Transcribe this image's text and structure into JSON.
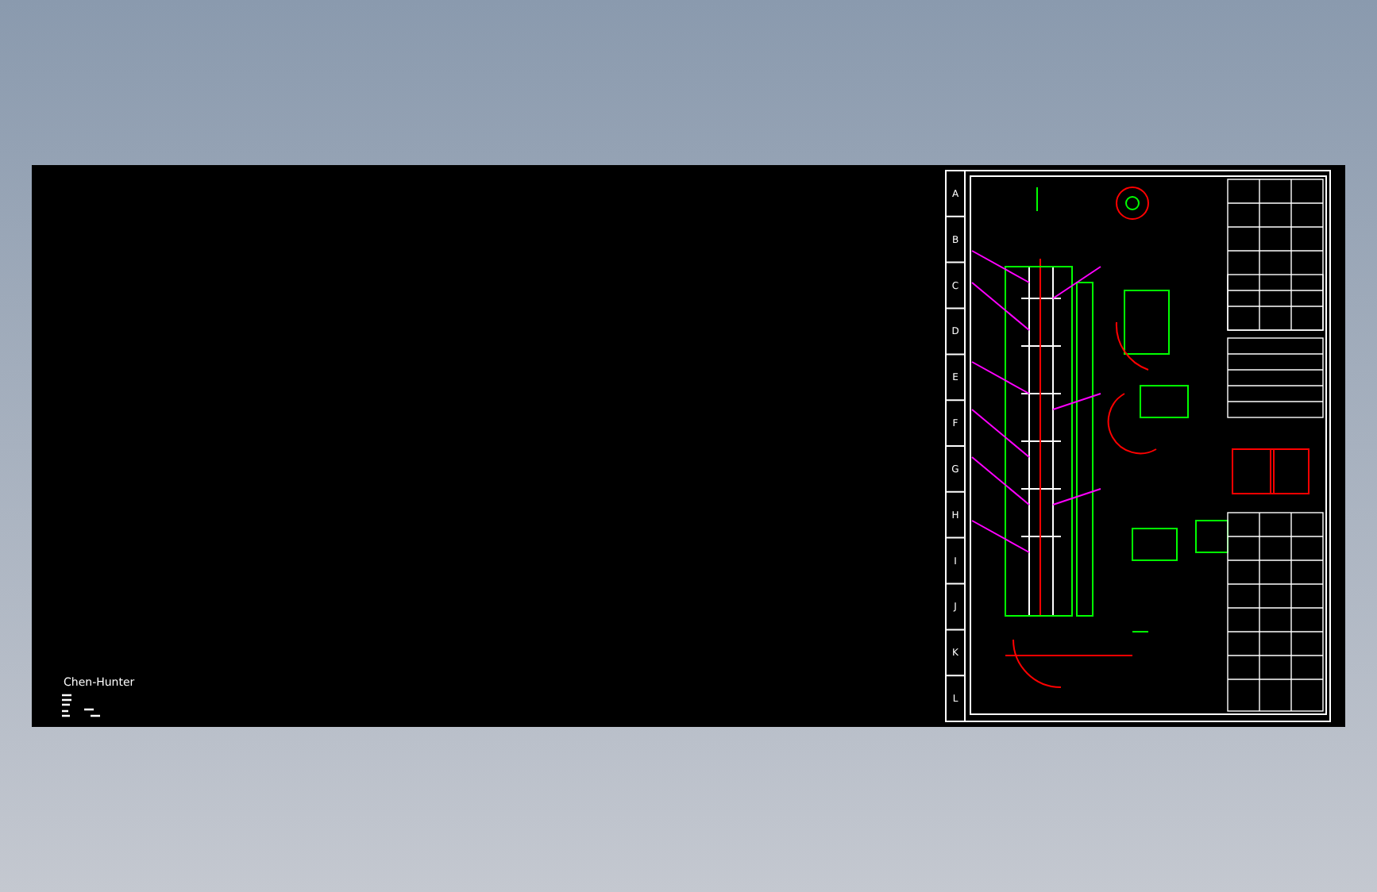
{
  "canvas": {
    "author": "Chen-Hunter"
  },
  "sheet": {
    "row_labels": [
      "A",
      "B",
      "C",
      "D",
      "E",
      "F",
      "G",
      "H",
      "I",
      "J",
      "K",
      "L"
    ]
  }
}
